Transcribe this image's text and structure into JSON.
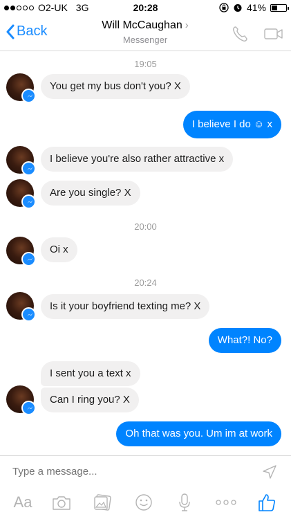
{
  "status_bar": {
    "carrier": "O2-UK",
    "network": "3G",
    "time": "20:28",
    "battery": "41%",
    "battery_level": 0.41,
    "signal_bars": 4
  },
  "nav": {
    "back_label": "Back",
    "contact_name": "Will McCaughan",
    "subtitle": "Messenger",
    "chevron": "›"
  },
  "messages": [
    {
      "type": "timestamp",
      "text": "19:05"
    },
    {
      "type": "incoming",
      "text": "You get my bus don't you? X"
    },
    {
      "type": "outgoing",
      "text": "I believe I do ☺ x"
    },
    {
      "type": "incoming",
      "text": "I believe you're also rather attractive x"
    },
    {
      "type": "incoming",
      "text": "Are you single? X"
    },
    {
      "type": "timestamp",
      "text": "20:00"
    },
    {
      "type": "incoming",
      "text": "Oi x"
    },
    {
      "type": "timestamp",
      "text": "20:24"
    },
    {
      "type": "incoming",
      "text": "Is it your boyfriend texting me? X"
    },
    {
      "type": "outgoing",
      "text": "What?! No?"
    },
    {
      "type": "incoming",
      "text": "I sent you a text x"
    },
    {
      "type": "incoming",
      "text": "Can I ring you? X"
    },
    {
      "type": "outgoing",
      "text": "Oh that was you. Um im at work"
    }
  ],
  "composer": {
    "placeholder": "Type a message...",
    "tools": [
      "text-format-icon",
      "camera-icon",
      "photos-icon",
      "emoji-icon",
      "microphone-icon",
      "more-icon",
      "like-icon"
    ],
    "aa_label": "Aa"
  },
  "colors": {
    "accent": "#0084ff",
    "incoming_bubble": "#f1f0f0",
    "timestamp": "#9b9b9b"
  }
}
